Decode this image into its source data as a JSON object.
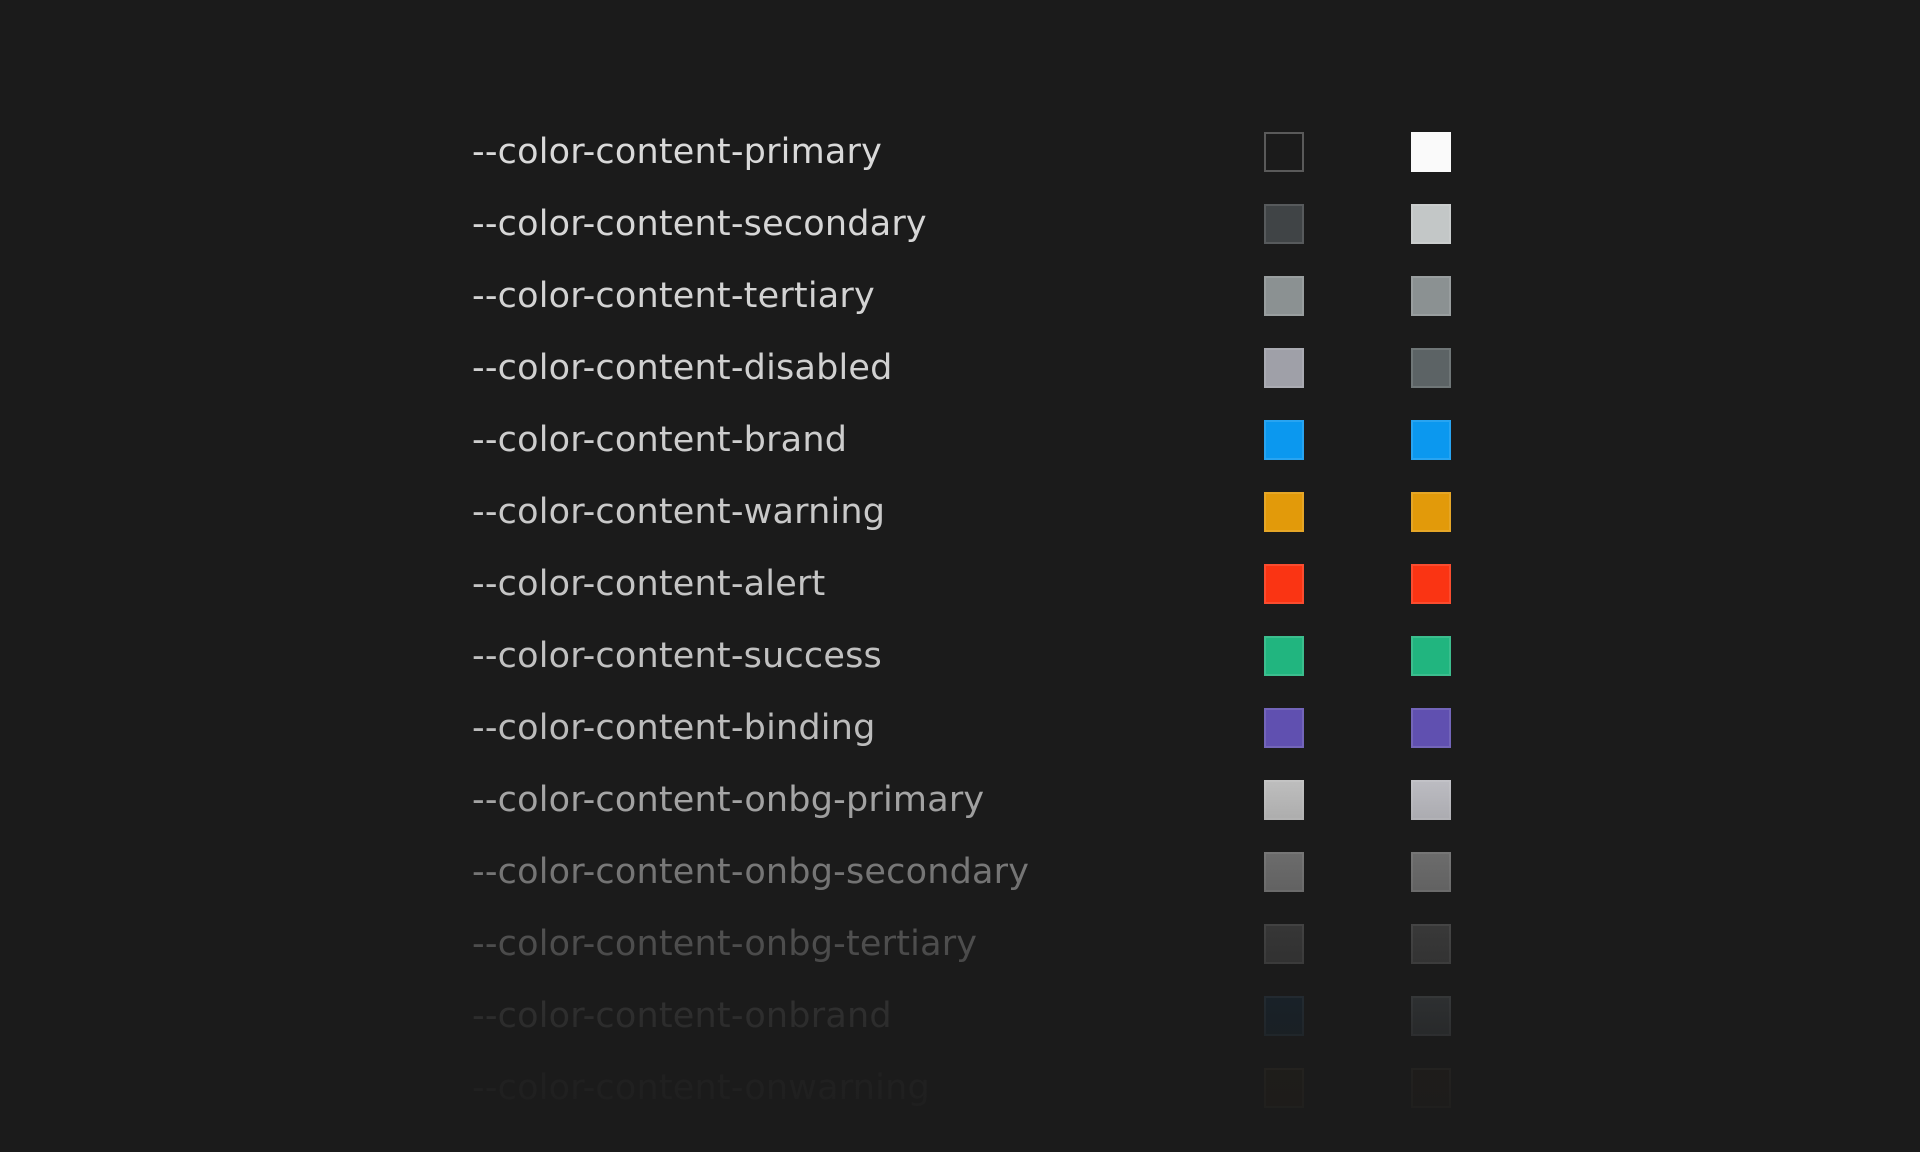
{
  "tokens": [
    {
      "name": "--color-content-primary",
      "light": "#1b1b1b",
      "dark": "#fafafa",
      "light_outline": true,
      "text_color": "#d9d9d9"
    },
    {
      "name": "--color-content-secondary",
      "light": "#404446",
      "dark": "#c3c7c7",
      "text_color": "#d6d6d6"
    },
    {
      "name": "--color-content-tertiary",
      "light": "#8b9192",
      "dark": "#8b9192",
      "text_color": "#d3d3d3"
    },
    {
      "name": "--color-content-disabled",
      "light": "#9fa0a8",
      "dark": "#5c6365",
      "text_color": "#d0d0d0"
    },
    {
      "name": "--color-content-brand",
      "light": "#0b98ef",
      "dark": "#0b98ef",
      "text_color": "#cdcdcd"
    },
    {
      "name": "--color-content-warning",
      "light": "#e29a0a",
      "dark": "#e29a0a",
      "text_color": "#c9c9c9"
    },
    {
      "name": "--color-content-alert",
      "light": "#fa3413",
      "dark": "#fa3413",
      "text_color": "#c5c5c5"
    },
    {
      "name": "--color-content-success",
      "light": "#21b57f",
      "dark": "#21b57f",
      "text_color": "#c1c1c1"
    },
    {
      "name": "--color-content-binding",
      "light": "#6050b0",
      "dark": "#6050b0",
      "text_color": "#bcbcbc"
    },
    {
      "name": "--color-content-onbg-primary",
      "light": "#c7c7c7",
      "dark": "#c5c5cb",
      "text_color": "#b3b3b3"
    },
    {
      "name": "--color-content-onbg-secondary",
      "light": "#858585",
      "dark": "#858585",
      "text_color": "#9a9a9a"
    },
    {
      "name": "--color-content-onbg-tertiary",
      "light": "#4b4b4b",
      "dark": "#4f4f4f",
      "text_color": "#7d7d7d"
    },
    {
      "name": "--color-content-onbrand",
      "light": "#152d40",
      "dark": "#4f5559",
      "text_color": "#585858"
    },
    {
      "name": "--color-content-onwarning",
      "light": "#2e2514",
      "dark": "#2b2319",
      "text_color": "#393939"
    }
  ]
}
